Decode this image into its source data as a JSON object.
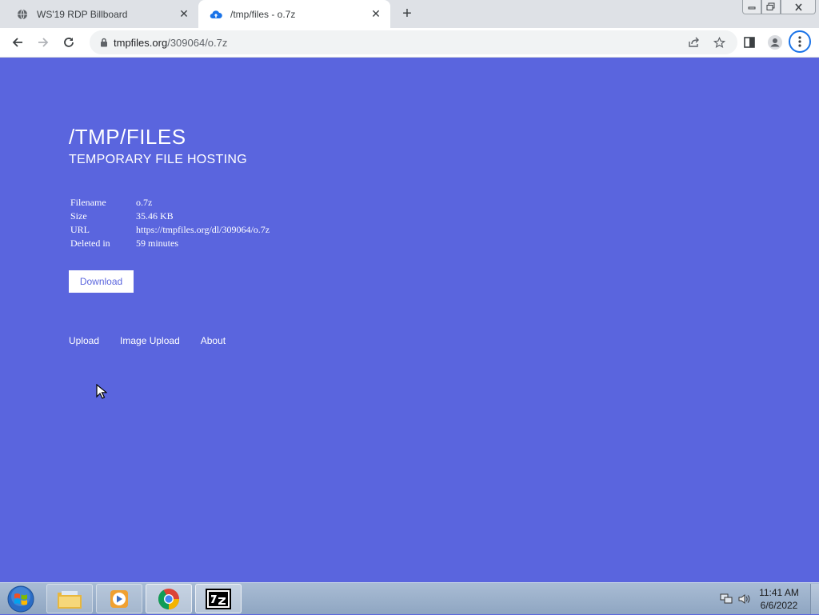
{
  "browser": {
    "tabs": [
      {
        "title": "WS'19 RDP Billboard",
        "icon": "globe-icon",
        "active": false
      },
      {
        "title": "/tmp/files - o.7z",
        "icon": "cloud-upload-icon",
        "active": true
      }
    ],
    "address": {
      "domain": "tmpfiles.org",
      "path": "/309064/o.7z"
    }
  },
  "page": {
    "title": "/TMP/FILES",
    "subtitle": "TEMPORARY FILE HOSTING",
    "file_info": [
      {
        "label": "Filename",
        "value": "o.7z"
      },
      {
        "label": "Size",
        "value": "35.46 KB"
      },
      {
        "label": "URL",
        "value": "https://tmpfiles.org/dl/309064/o.7z"
      },
      {
        "label": "Deleted in",
        "value": "59 minutes"
      }
    ],
    "download_label": "Download",
    "nav": [
      "Upload",
      "Image Upload",
      "About"
    ]
  },
  "taskbar": {
    "items": [
      "windows-explorer",
      "media-player",
      "chrome",
      "7-zip"
    ],
    "time": "11:41 AM",
    "date": "6/6/2022"
  },
  "colors": {
    "page_bg": "#5a65de",
    "accent": "#1a73e8"
  }
}
